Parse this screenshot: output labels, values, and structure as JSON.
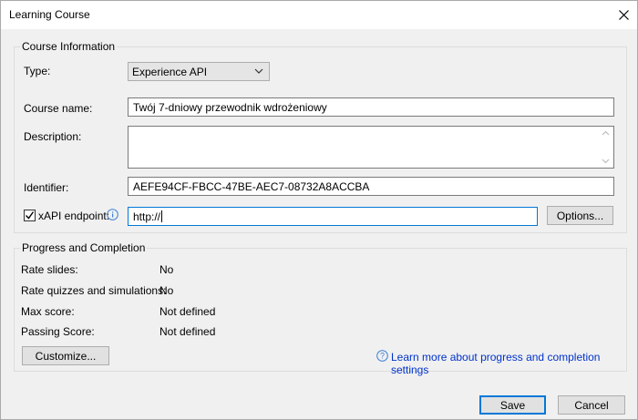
{
  "window": {
    "title": "Learning Course"
  },
  "course_info": {
    "group_label": "Course Information",
    "type_label": "Type:",
    "type_value": "Experience API",
    "course_name_label": "Course name:",
    "course_name_value": "Twój 7-dniowy przewodnik wdrożeniowy",
    "description_label": "Description:",
    "description_value": "",
    "identifier_label": "Identifier:",
    "identifier_value": "AEFE94CF-FBCC-47BE-AEC7-08732A8ACCBA",
    "xapi_label": "xAPI endpoint:",
    "xapi_checked": true,
    "xapi_value": "http://",
    "options_button": "Options..."
  },
  "progress": {
    "group_label": "Progress and Completion",
    "rows": [
      {
        "label": "Rate slides:",
        "value": "No"
      },
      {
        "label": "Rate quizzes and simulations:",
        "value": "No"
      },
      {
        "label": "Max score:",
        "value": "Not defined"
      },
      {
        "label": "Passing Score:",
        "value": "Not defined"
      }
    ],
    "customize_button": "Customize...",
    "learn_more_link": "Learn more about progress and completion settings"
  },
  "footer": {
    "save_button": "Save",
    "cancel_button": "Cancel"
  },
  "colors": {
    "accent": "#0078d7",
    "link": "#0033cc",
    "background": "#f0f0f0"
  },
  "icons": {
    "close": "close-icon",
    "dropdown": "chevron-down-icon",
    "info": "info-icon",
    "help": "help-icon"
  }
}
